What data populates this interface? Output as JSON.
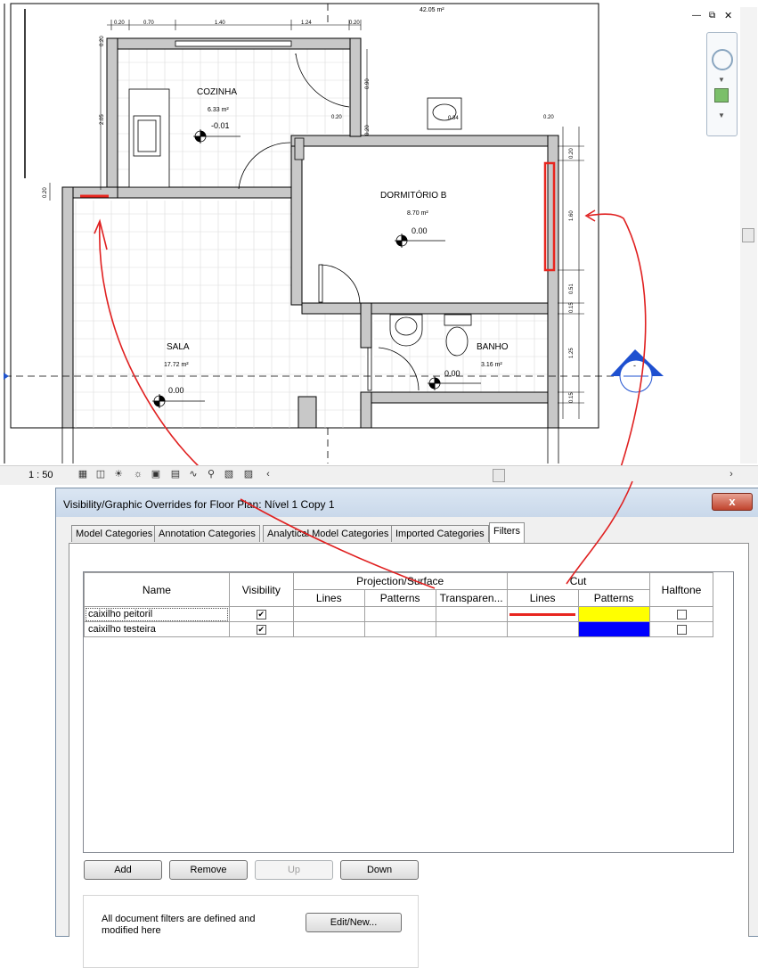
{
  "drawing": {
    "top_dimension": "42.05 m²",
    "top_dims": [
      "0.20",
      "0.70",
      "1.40",
      "1.24",
      "0.20"
    ],
    "left_dims": [
      "0.20",
      "2.05",
      "0.20"
    ],
    "mid_dims": [
      "0.90",
      "0.20",
      "0.20",
      "0.20"
    ],
    "right_dims": [
      "0.20",
      "1.60",
      "0.51",
      "0.15",
      "1.25",
      "0.15"
    ],
    "rooms": [
      {
        "name": "COZINHA",
        "area": "6.33 m²",
        "level": "-0.01"
      },
      {
        "name": "DORMITÓRIO B",
        "area": "8.70 m²",
        "level": "0.00"
      },
      {
        "name": "SALA",
        "area": "17.72 m²",
        "level": "0.00"
      },
      {
        "name": "BANHO",
        "area": "3.16 m²",
        "level": "0.00"
      }
    ],
    "fixture_label": "0.34",
    "section_marker": "-"
  },
  "view_controls": {
    "scale": "1 : 50"
  },
  "dialog": {
    "title": "Visibility/Graphic Overrides for Floor Plan: Nível 1 Copy 1",
    "close_label": "x",
    "tabs": [
      "Model Categories",
      "Annotation Categories",
      "Analytical Model Categories",
      "Imported Categories",
      "Filters"
    ],
    "active_tab": "Filters",
    "table": {
      "headers": {
        "name": "Name",
        "visibility": "Visibility",
        "projection_surface": "Projection/Surface",
        "lines": "Lines",
        "patterns": "Patterns",
        "transparency": "Transparen...",
        "cut": "Cut",
        "cut_lines": "Lines",
        "cut_patterns": "Patterns",
        "halftone": "Halftone"
      },
      "rows": [
        {
          "name": "caixilho peitoril",
          "visible": true,
          "cut_line_color": "#e8261f",
          "cut_pattern_color": "#ffff00",
          "halftone": false
        },
        {
          "name": "caixilho testeira",
          "visible": true,
          "cut_line_color": "",
          "cut_pattern_color": "#0000ff",
          "halftone": false
        }
      ]
    },
    "buttons": {
      "add": "Add",
      "remove": "Remove",
      "up": "Up",
      "down": "Down",
      "edit_new": "Edit/New..."
    },
    "info_text": "All document filters are defined and modified here"
  },
  "annotation_color": "#e02020"
}
